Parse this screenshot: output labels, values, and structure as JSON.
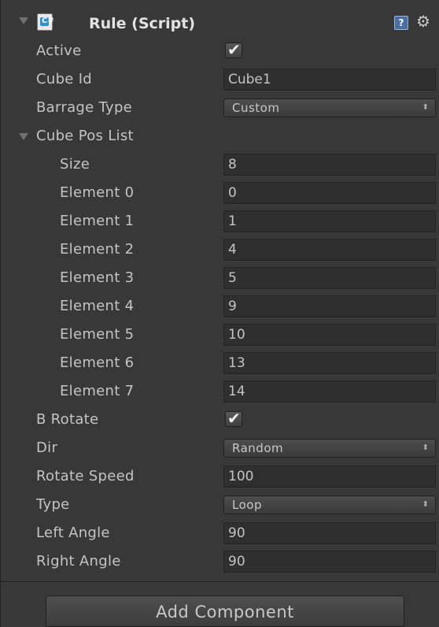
{
  "component": {
    "title": "Rule (Script)",
    "script_icon_glyph": "C#",
    "help_glyph": "?",
    "gear_glyph": "⚙"
  },
  "fields": {
    "active_label": "Active",
    "active_checked": true,
    "cube_id_label": "Cube Id",
    "cube_id_value": "Cube1",
    "barrage_type_label": "Barrage Type",
    "barrage_type_value": "Custom",
    "cube_pos_list_label": "Cube Pos List",
    "size_label": "Size",
    "size_value": "8",
    "elements": [
      {
        "label": "Element 0",
        "value": "0"
      },
      {
        "label": "Element 1",
        "value": "1"
      },
      {
        "label": "Element 2",
        "value": "4"
      },
      {
        "label": "Element 3",
        "value": "5"
      },
      {
        "label": "Element 4",
        "value": "9"
      },
      {
        "label": "Element 5",
        "value": "10"
      },
      {
        "label": "Element 6",
        "value": "13"
      },
      {
        "label": "Element 7",
        "value": "14"
      }
    ],
    "b_rotate_label": "B Rotate",
    "b_rotate_checked": true,
    "dir_label": "Dir",
    "dir_value": "Random",
    "rotate_speed_label": "Rotate Speed",
    "rotate_speed_value": "100",
    "type_label": "Type",
    "type_value": "Loop",
    "left_angle_label": "Left Angle",
    "left_angle_value": "90",
    "right_angle_label": "Right Angle",
    "right_angle_value": "90"
  },
  "footer": {
    "add_component_label": "Add Component"
  },
  "glyphs": {
    "check": "✔",
    "dropdown_arrows": "⬍"
  },
  "colors": {
    "panel_bg": "#383838",
    "field_bg": "#2f2f2f",
    "text": "#c4c4c4"
  }
}
